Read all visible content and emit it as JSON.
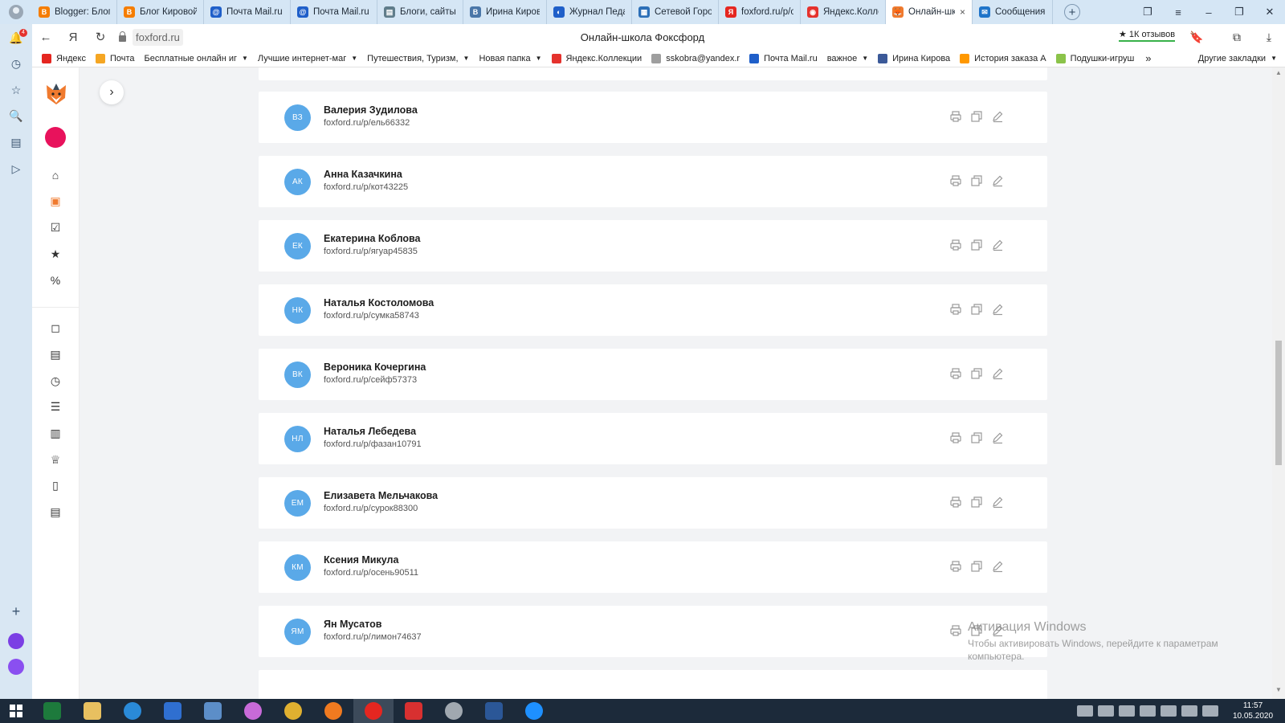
{
  "browser": {
    "tabs": [
      {
        "title": "Blogger: Блог",
        "color": "#f57d00",
        "glyph": "B"
      },
      {
        "title": "Блог Кировой",
        "color": "#f57d00",
        "glyph": "B"
      },
      {
        "title": "Почта Mail.ru",
        "color": "#1f5fc9",
        "glyph": "@"
      },
      {
        "title": "Почта Mail.ru",
        "color": "#1f5fc9",
        "glyph": "@"
      },
      {
        "title": "Блоги, сайты",
        "color": "#607d8b",
        "glyph": "▤"
      },
      {
        "title": "Ирина Кирова",
        "color": "#4a76a8",
        "glyph": "В"
      },
      {
        "title": "Журнал Педа",
        "color": "#1f5fc9",
        "glyph": "◐"
      },
      {
        "title": "Сетевой Горо",
        "color": "#2c6fb7",
        "glyph": "▦"
      },
      {
        "title": "foxford.ru/p/o",
        "color": "#e52620",
        "glyph": "Я"
      },
      {
        "title": "Яндекс.Колле",
        "color": "#e5322d",
        "glyph": "◉"
      },
      {
        "title": "Онлайн-шк",
        "color": "#f07a2e",
        "glyph": "🦊",
        "active": true
      },
      {
        "title": "Сообщения",
        "color": "#1f74c9",
        "glyph": "✉"
      }
    ],
    "active_tab_close": "×",
    "new_tab": "+",
    "address": {
      "back": "←",
      "yandex_btn": "Я",
      "reload": "↻",
      "url": "foxford.ru",
      "page_title": "Онлайн-школа Фоксфорд",
      "reviews": "★ 1К отзывов"
    },
    "bookmarks": [
      {
        "label": "Яндекс",
        "color": "#e52620"
      },
      {
        "label": "Почта",
        "color": "#f5a623"
      },
      {
        "label": "Бесплатные онлайн иг",
        "dropdown": true,
        "color": ""
      },
      {
        "label": "Лучшие интернет-маг",
        "dropdown": true,
        "color": ""
      },
      {
        "label": "Путешествия, Туризм,",
        "dropdown": true,
        "color": ""
      },
      {
        "label": "Новая папка",
        "dropdown": true,
        "color": ""
      },
      {
        "label": "Яндекс.Коллекции",
        "color": "#e5322d"
      },
      {
        "label": "sskobra@yandex.r",
        "color": "#9e9e9e"
      },
      {
        "label": "Почта Mail.ru",
        "color": "#1f5fc9"
      },
      {
        "label": "важное",
        "dropdown": true,
        "color": ""
      },
      {
        "label": "Ирина Кирова",
        "color": "#3b5998"
      },
      {
        "label": "История заказа А",
        "color": "#ff9800"
      },
      {
        "label": "Подушки-игруш",
        "color": "#8bc34a"
      }
    ],
    "bookmarks_more": "»",
    "bookmarks_other": "Другие закладки"
  },
  "students": [
    {
      "initials": "ВЗ",
      "name": "Валерия Зудилова",
      "link": "foxford.ru/p/ель66332"
    },
    {
      "initials": "АК",
      "name": "Анна Казачкина",
      "link": "foxford.ru/p/кот43225"
    },
    {
      "initials": "ЕК",
      "name": "Екатерина Коблова",
      "link": "foxford.ru/p/ягуар45835"
    },
    {
      "initials": "НК",
      "name": "Наталья Костоломова",
      "link": "foxford.ru/p/сумка58743"
    },
    {
      "initials": "ВК",
      "name": "Вероника Кочергина",
      "link": "foxford.ru/p/сейф57373"
    },
    {
      "initials": "НЛ",
      "name": "Наталья Лебедева",
      "link": "foxford.ru/p/фазан10791"
    },
    {
      "initials": "ЕМ",
      "name": "Елизавета Мельчакова",
      "link": "foxford.ru/p/сурок88300"
    },
    {
      "initials": "КМ",
      "name": "Ксения Микула",
      "link": "foxford.ru/p/осень90511"
    },
    {
      "initials": "ЯМ",
      "name": "Ян Мусатов",
      "link": "foxford.ru/p/лимон74637"
    }
  ],
  "watermark": {
    "title": "Активация Windows",
    "text": "Чтобы активировать Windows, перейдите к параметрам компьютера."
  },
  "taskbar": {
    "time": "11:57",
    "date": "10.05.2020"
  },
  "colors": {
    "avatar": "#5aa9e8",
    "accent_pink": "#e8125c",
    "rail_active": "#f07a2e"
  }
}
